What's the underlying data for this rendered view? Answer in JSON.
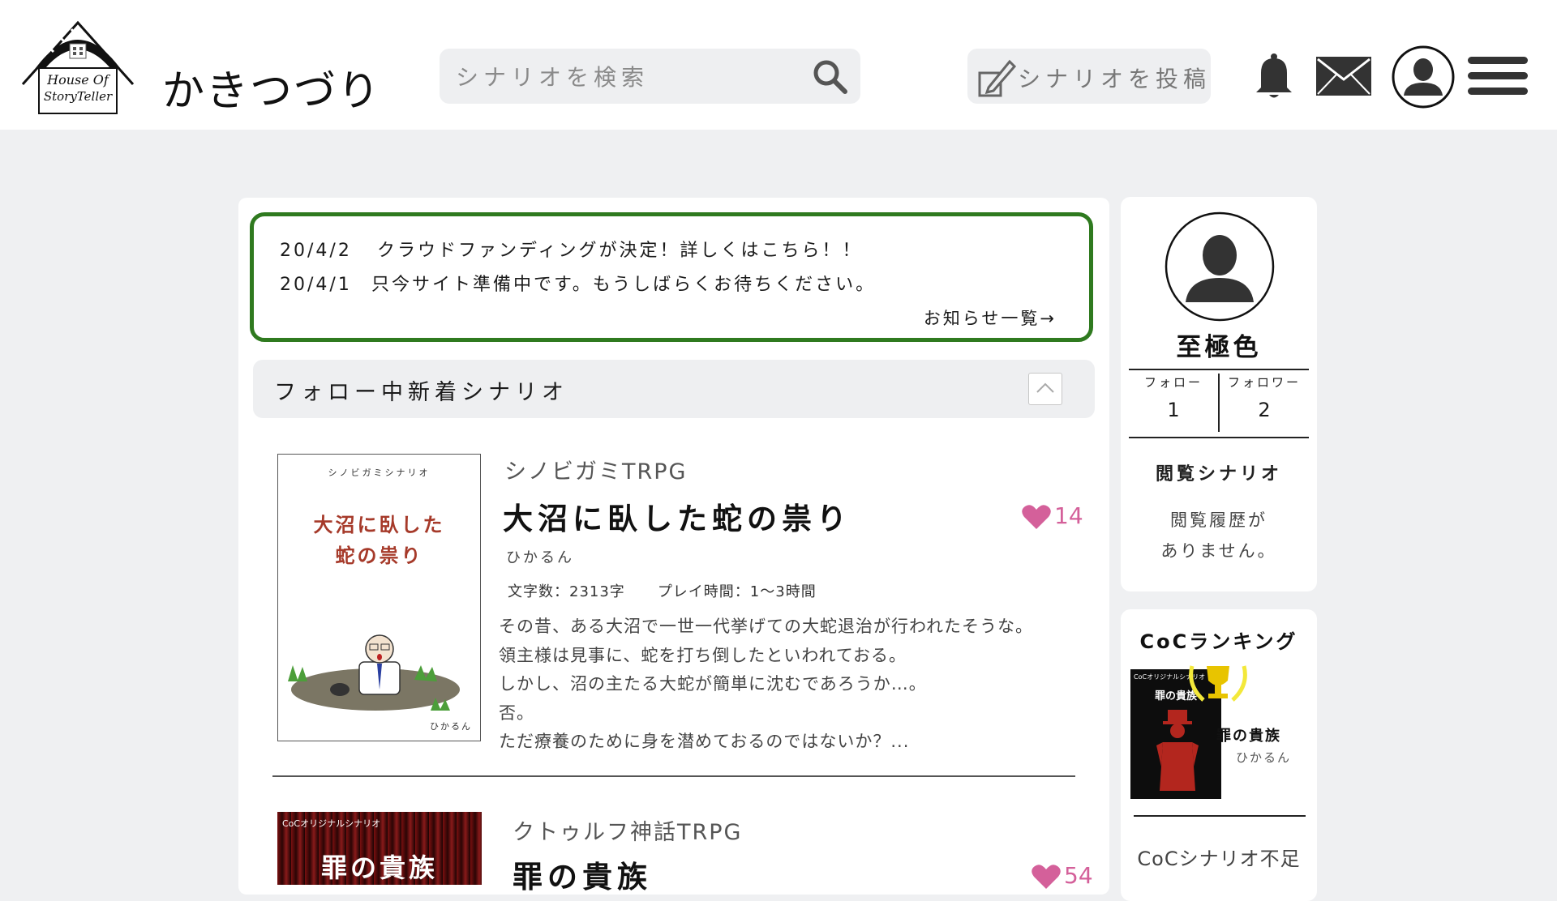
{
  "header": {
    "logo_line1": "House Of",
    "logo_line2": "StoryTeller",
    "brand": "かきつづり",
    "search_placeholder": "シナリオを検索",
    "post_label": "シナリオを投稿"
  },
  "notices": {
    "items": [
      {
        "date": "20/4/2",
        "text": "クラウドファンディングが決定！詳しくはこちら！！"
      },
      {
        "date": "20/4/1",
        "text": "只今サイト準備中です。もうしばらくお待ちください。"
      }
    ],
    "more": "お知らせ一覧→",
    "border_color": "#2f7a1f"
  },
  "section": {
    "title": "フォロー中新着シナリオ"
  },
  "scenarios": [
    {
      "cover_series": "シノビガミシナリオ",
      "cover_title_line1": "大沼に臥した",
      "cover_title_line2": "蛇の祟り",
      "cover_author": "ひかるん",
      "category": "シノビガミTRPG",
      "title": "大沼に臥した蛇の祟り",
      "likes": "14",
      "author": "ひかるん",
      "char_count": "文字数：2313字",
      "play_time": "プレイ時間：1～3時間",
      "description": [
        "その昔、ある大沼で一世一代挙げての大蛇退治が行われたそうな。",
        "領主様は見事に、蛇を打ち倒したといわれておる。",
        "しかし、沼の主たる大蛇が簡単に沈むであろうか…。",
        "否。",
        "ただ療養のために身を潜めておるのではないか？..."
      ]
    },
    {
      "cover_label": "CoCオリジナルシナリオ",
      "cover_title": "罪の貴族",
      "category": "クトゥルフ神話TRPG",
      "title": "罪の貴族",
      "likes": "54"
    }
  ],
  "profile": {
    "name": "至極色",
    "follow_label": "フォロー",
    "follow_count": "1",
    "follower_label": "フォロワー",
    "follower_count": "2",
    "recent_title": "閲覧シナリオ",
    "recent_empty_line1": "閲覧履歴が",
    "recent_empty_line2": "ありません。"
  },
  "ranking": {
    "title": "CoCランキング",
    "cover_label": "CoCオリジナルシナリオ",
    "cover_title": "罪の貴族",
    "top_title": "罪の貴族",
    "top_author": "ひかるん",
    "next_title": "CoCシナリオ不足"
  },
  "colors": {
    "accent_like": "#d4609a",
    "notice_border": "#2f7a1f"
  },
  "icons": [
    "search-icon",
    "pencil-icon",
    "bell-icon",
    "mail-icon",
    "user-icon",
    "hamburger-icon",
    "heart-icon",
    "chevron-up-icon",
    "trophy-icon"
  ]
}
